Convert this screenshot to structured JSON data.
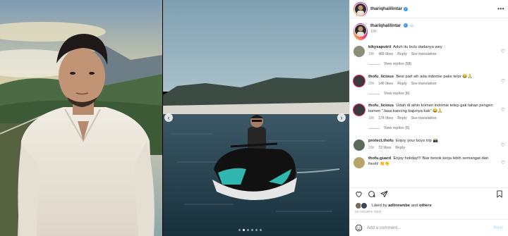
{
  "post": {
    "username": "thariqhalilintar",
    "caption_text": "☁️",
    "caption_time": "19h",
    "liked_by_prefix": "Liked by ",
    "liked_by_user": "adlinrambe",
    "liked_by_suffix": " and ",
    "liked_by_others": "others",
    "posted_ago": "20 HOURS AGO"
  },
  "comments": [
    {
      "user": "kikysaputrii",
      "text": "Aduh itu bulu dadanya wey",
      "time": "19h",
      "likes": "469 likes",
      "reply": "Reply",
      "translate": "See translation",
      "replies": "View replies (58)",
      "avatar_color": "#8a8f7a"
    },
    {
      "user": "thofu_licious",
      "text": "Best part sih ada indomie pake telor 😂🙏",
      "time": "20h",
      "likes": "140 likes",
      "reply": "Reply",
      "translate": "See translation",
      "replies": "View replies (6)",
      "avatar_color": "#3a3a3a"
    },
    {
      "user": "thofu_licious",
      "text": "Udah di aihin komen indomie tetep gak tahan pengen komen \"Jasa kancing bajunya kak\" 😂🙏",
      "time": "19h",
      "likes": "174 likes",
      "reply": "Reply",
      "translate": "See translation",
      "replies": "View replies (5)",
      "avatar_color": "#3a3a3a"
    },
    {
      "user": "protect.thofu",
      "text": "Enjoy your boys trip 📸",
      "time": "20h",
      "likes": "72 likes",
      "reply": "Reply",
      "translate": "",
      "replies": "",
      "avatar_color": "#5a6b5a"
    },
    {
      "user": "thofu.guard",
      "text": "Enjoy holiday!!! Biar besok kerja lebih semangat dan fresh! 👏👏",
      "time": "",
      "likes": "",
      "reply": "",
      "translate": "",
      "replies": "",
      "avatar_color": "#b8a36a"
    }
  ],
  "comment_box": {
    "placeholder": "Add a comment...",
    "post_label": "Post"
  },
  "carousel": {
    "slides": 6,
    "active_index": 1
  },
  "colors": {
    "link_blue": "#3897f0",
    "post_disabled": "#b2dffc",
    "muted": "#8e8e8e"
  },
  "icons": [
    "more-icon",
    "heart-icon",
    "comment-icon",
    "share-icon",
    "bookmark-icon",
    "emoji-icon",
    "chevron-left-icon",
    "chevron-right-icon",
    "verified-icon"
  ]
}
